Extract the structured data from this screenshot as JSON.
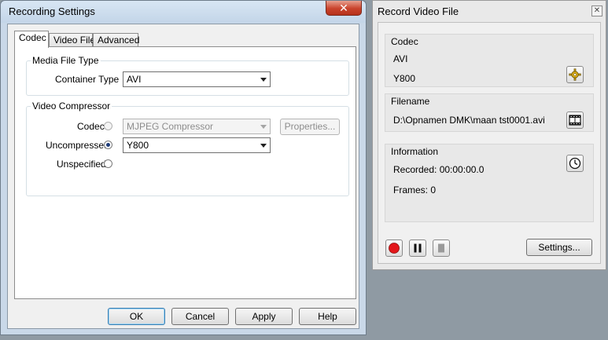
{
  "settings_window": {
    "title": "Recording Settings",
    "close_glyph": "✕",
    "tabs": [
      {
        "label": "Codec",
        "active": true
      },
      {
        "label": "Video File",
        "active": false
      },
      {
        "label": "Advanced",
        "active": false
      }
    ],
    "media_file_type": {
      "group_label": "Media File Type",
      "container_label": "Container Type",
      "container_value": "AVI"
    },
    "video_compressor": {
      "group_label": "Video Compressor",
      "codec_label": "Codec",
      "codec_value": "MJPEG Compressor",
      "properties_label": "Properties...",
      "uncompressed_label": "Uncompressed",
      "uncompressed_value": "Y800",
      "unspecified_label": "Unspecified",
      "selected": "uncompressed"
    },
    "buttons": {
      "ok": "OK",
      "cancel": "Cancel",
      "apply": "Apply",
      "help": "Help"
    }
  },
  "record_window": {
    "title": "Record Video File",
    "close_glyph": "✕",
    "codec": {
      "title": "Codec",
      "format": "AVI",
      "compression": "Y800",
      "icon": "gear-icon"
    },
    "filename": {
      "title": "Filename",
      "path": "D:\\Opnamen DMK\\maan tst0001.avi",
      "icon": "film-folder-icon"
    },
    "information": {
      "title": "Information",
      "recorded": "Recorded: 00:00:00.0",
      "frames": "Frames: 0",
      "icon": "clock-icon"
    },
    "controls": {
      "record_icon": "record-icon",
      "pause_icon": "pause-icon",
      "stop_icon": "stop-icon",
      "settings_label": "Settings...",
      "record_color": "#e3171b"
    }
  }
}
